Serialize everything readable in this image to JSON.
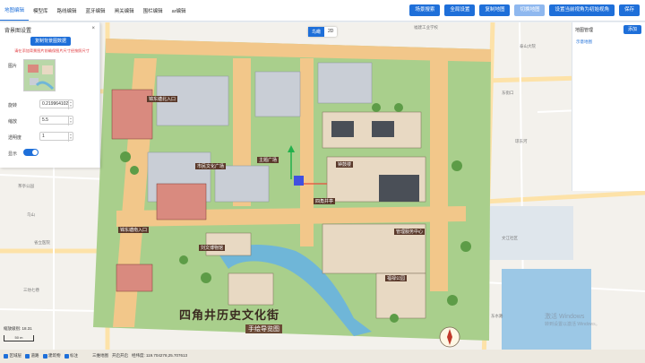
{
  "tabs": [
    "地图编辑",
    "模型库",
    "路线编辑",
    "蓝牙编辑",
    "闸关编辑",
    "围栏编辑",
    "ar编辑"
  ],
  "active_tab": 0,
  "top_buttons": [
    "场景搜索",
    "全局设置",
    "复制地图",
    "切换地图",
    "设置当前视角为初始视角",
    "保存"
  ],
  "view_toggle": {
    "a": "鸟瞰",
    "b": "2D"
  },
  "left_panel": {
    "title": "背景图设置",
    "close": "×",
    "copy_button": "复制背景图数据",
    "hint": "请在添加背景图片前确保图片尺寸经按照尺寸",
    "image_label": "图片",
    "rotation_label": "旋转",
    "rotation_value": "0.219964102",
    "scale_label": "缩放",
    "scale_value": "5.5",
    "opacity_label": "透明度",
    "opacity_value": "1",
    "show_label": "显示"
  },
  "right_panel": {
    "title": "地图管理",
    "add_button": "添加",
    "item": "示意地图"
  },
  "map_labels": {
    "title_main": "四角井历史文化街",
    "title_sub": "手绘导览图",
    "entrance_n": "锦东塘北入口",
    "entrance_s": "锦东塘南入口",
    "plaza": "主题广场",
    "labels": [
      "四角井亭",
      "钟鼓楼",
      "中山广场",
      "城中游乐场",
      "刘文博物馆",
      "光合居",
      "文化馆",
      "民俗馆",
      "管理服务中心",
      "福禄公园",
      "市民文化广场",
      "陈家祠"
    ]
  },
  "base_map_labels": [
    "福建工业学校",
    "博文中学",
    "泰山大院",
    "东街口",
    "鼓楼区",
    "琼东河",
    "文江社区",
    "福州市鼓楼区",
    "上津路",
    "第一医院",
    "茶亭公园",
    "乌山",
    "省立医院",
    "三坊七巷",
    "白马路",
    "杨桥路",
    "东水路"
  ],
  "scale": {
    "zoom": "缩放级别: 18.31",
    "bar": "50 m"
  },
  "bottom": {
    "checks": [
      "区域层",
      "道路",
      "建筑物",
      "标注"
    ],
    "stats": [
      "三维地图",
      "开启开启",
      "经纬度: 119.704278,25.707613"
    ]
  },
  "watermark": [
    "激活 Windows",
    "转到设置以激活 Windows。"
  ],
  "colors": {
    "accent": "#1e6fd9",
    "danger": "#e0393e",
    "road": "#f2c78a",
    "water": "#6fb6d8",
    "grass": "#a9cf8c"
  }
}
